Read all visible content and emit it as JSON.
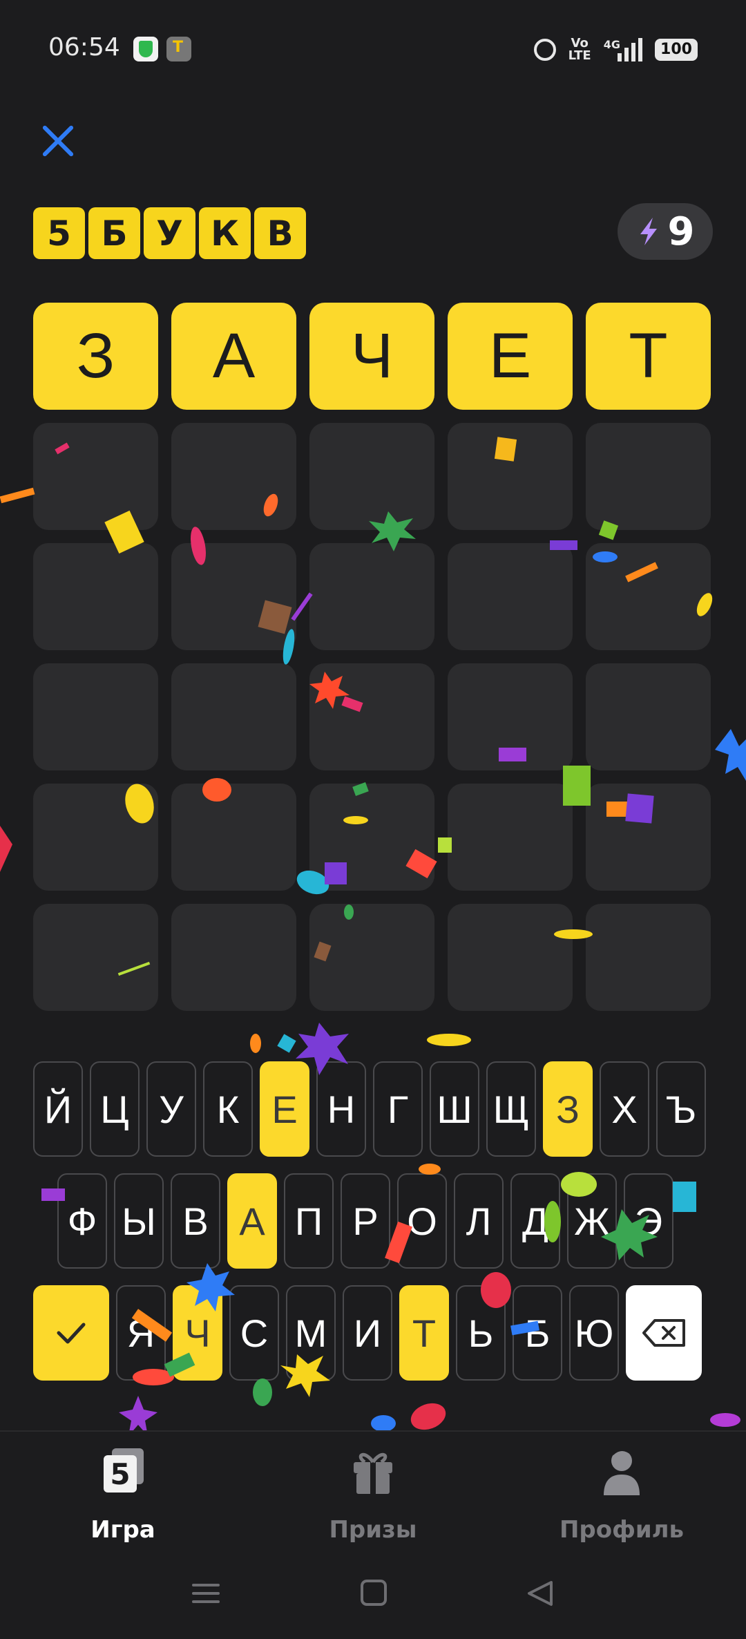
{
  "status_bar": {
    "time": "06:54",
    "volte": "Vo LTE",
    "network": "4G",
    "battery": "100"
  },
  "header": {
    "logo_letters": [
      "5",
      "Б",
      "У",
      "К",
      "В"
    ],
    "energy_count": "9"
  },
  "board": {
    "rows": [
      [
        "З",
        "А",
        "Ч",
        "Е",
        "Т"
      ],
      [
        "",
        "",
        "",
        "",
        ""
      ],
      [
        "",
        "",
        "",
        "",
        ""
      ],
      [
        "",
        "",
        "",
        "",
        ""
      ],
      [
        "",
        "",
        "",
        "",
        ""
      ],
      [
        "",
        "",
        "",
        "",
        ""
      ]
    ],
    "colors": {
      "correct": "#fcd92c",
      "empty": "#2c2c2e"
    }
  },
  "keyboard": {
    "row1": [
      "Й",
      "Ц",
      "У",
      "К",
      "Е",
      "Н",
      "Г",
      "Ш",
      "Щ",
      "З",
      "Х",
      "Ъ"
    ],
    "row2": [
      "Ф",
      "Ы",
      "В",
      "А",
      "П",
      "Р",
      "О",
      "Л",
      "Д",
      "Ж",
      "Э"
    ],
    "row3": [
      "Я",
      "Ч",
      "С",
      "М",
      "И",
      "Т",
      "Ь",
      "Б",
      "Ю"
    ],
    "enter_icon": "checkmark-icon",
    "backspace_icon": "backspace-icon"
  },
  "tabs": [
    {
      "label": "Игра",
      "icon": "game-icon",
      "active": true
    },
    {
      "label": "Призы",
      "icon": "gift-icon",
      "active": false
    },
    {
      "label": "Профиль",
      "icon": "profile-icon",
      "active": false
    }
  ],
  "nav": {
    "icons": [
      "menu-icon",
      "home-icon",
      "back-icon"
    ]
  }
}
